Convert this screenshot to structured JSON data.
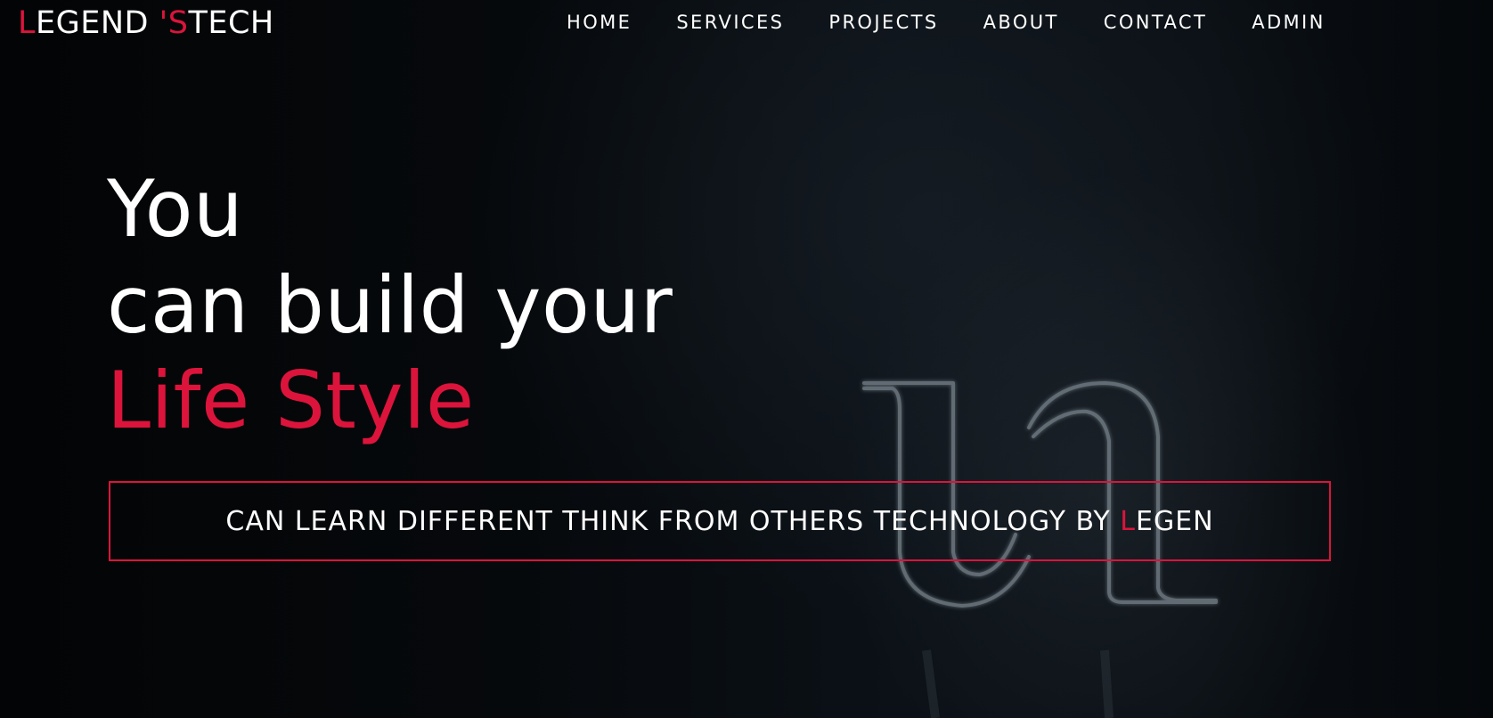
{
  "logo": {
    "first": "L",
    "part2": "EGEND ",
    "apostrophe_s": "'S",
    "part3": "TECH"
  },
  "nav": {
    "items": [
      {
        "label": "HOME"
      },
      {
        "label": "SERVICES"
      },
      {
        "label": "PROJECTS"
      },
      {
        "label": "ABOUT"
      },
      {
        "label": "CONTACT"
      },
      {
        "label": "ADMIN"
      }
    ]
  },
  "hero": {
    "line1": "You",
    "line2": "can build your",
    "line3": "Life Style",
    "tagline_main": "CAN LEARN DIFFERENT THINK FROM OTHERS TECHNOLOGY BY ",
    "tagline_accent": "L",
    "tagline_end": "EGEN"
  },
  "colors": {
    "accent": "#dc143c",
    "text": "#ffffff",
    "background": "#05080b"
  },
  "icons": {
    "hero_art": "neon-letter-sign"
  }
}
